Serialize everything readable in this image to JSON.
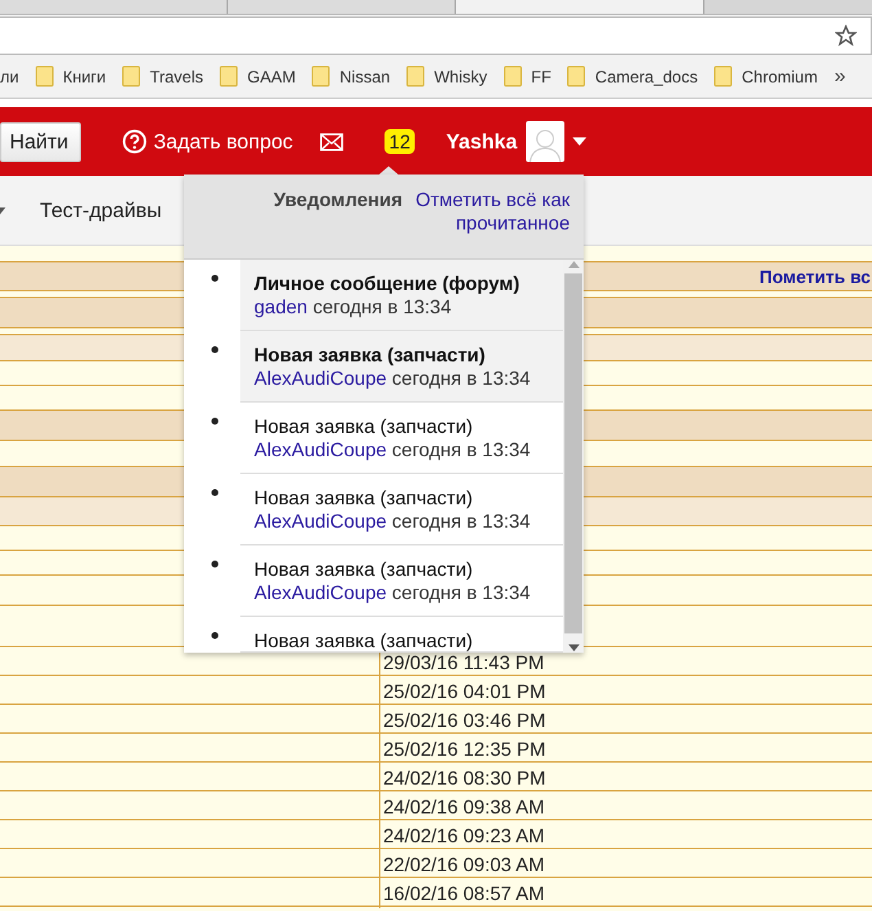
{
  "browser": {
    "tabs": [
      {
        "selected": false
      },
      {
        "selected": false
      },
      {
        "selected": true
      }
    ],
    "bookmarks": [
      {
        "label": "ли",
        "folder": false
      },
      {
        "label": "Книги",
        "folder": true
      },
      {
        "label": "Travels",
        "folder": true
      },
      {
        "label": "GAAM",
        "folder": true
      },
      {
        "label": "Nissan",
        "folder": true
      },
      {
        "label": "Whisky",
        "folder": true
      },
      {
        "label": "FF",
        "folder": true
      },
      {
        "label": "Camera_docs",
        "folder": true
      },
      {
        "label": "Chromium",
        "folder": true
      }
    ],
    "more": "»"
  },
  "header": {
    "search_button": "Найти",
    "ask": "Задать вопрос",
    "badge": "12",
    "user": "Yashka"
  },
  "nav": {
    "items": [
      "Тест-драйвы"
    ]
  },
  "notifications": {
    "title": "Уведомления",
    "mark_all": "Отметить всё как прочитанное",
    "items": [
      {
        "title": "Личное сообщение (форум)",
        "author": "gaden",
        "time": "сегодня в 13:34",
        "unread": true
      },
      {
        "title": "Новая заявка (запчасти)",
        "author": "AlexAudiCoupe",
        "time": "сегодня в 13:34",
        "unread": true
      },
      {
        "title": "Новая заявка (запчасти)",
        "author": "AlexAudiCoupe",
        "time": "сегодня в 13:34",
        "unread": false
      },
      {
        "title": "Новая заявка (запчасти)",
        "author": "AlexAudiCoupe",
        "time": "сегодня в 13:34",
        "unread": false
      },
      {
        "title": "Новая заявка (запчасти)",
        "author": "AlexAudiCoupe",
        "time": "сегодня в 13:34",
        "unread": false
      },
      {
        "title": "Новая заявка (запчасти)",
        "unread": false
      }
    ]
  },
  "table": {
    "mark_link": "Пометить вс",
    "dates": [
      "29/03/16 11:43 PM",
      "25/02/16 04:01 PM",
      "25/02/16 03:46 PM",
      "25/02/16 12:35 PM",
      "24/02/16 08:30 PM",
      "24/02/16 09:38 AM",
      "24/02/16 09:23 AM",
      "22/02/16 09:03 AM",
      "16/02/16 08:57 AM"
    ]
  }
}
